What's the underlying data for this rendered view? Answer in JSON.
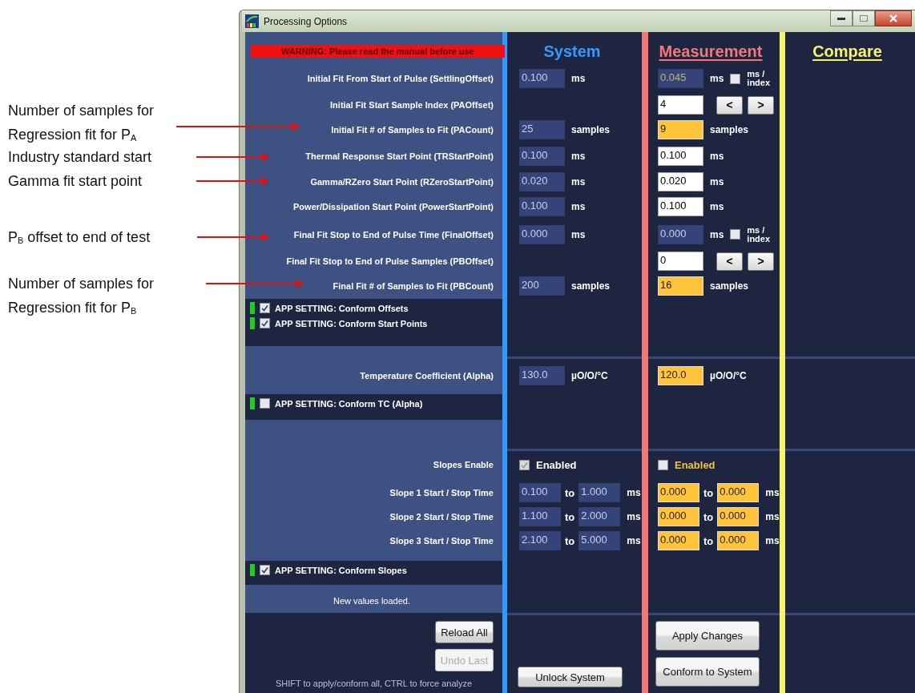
{
  "annotations": [
    {
      "text": "Number of samples for Regression fit for P$_{A}$"
    },
    {
      "text": "Industry standard start"
    },
    {
      "text": "Gamma fit start point"
    },
    {
      "text": "P$_{B}$ offset to end of test"
    },
    {
      "text": "Number of samples for Regression fit for P$_{B}$"
    }
  ],
  "window": {
    "title": "Processing Options"
  },
  "warning": "WARNING: Please read the manual before use",
  "columns": [
    {
      "title": "System",
      "color": "#3399ff",
      "underlined": false
    },
    {
      "title": "Measurement",
      "color": "#f27878",
      "underlined": true
    },
    {
      "title": "Compare",
      "color": "#f8f46a",
      "underlined": true
    }
  ],
  "params": [
    {
      "label": "Initial Fit From Start of Pulse (SettlingOffset)",
      "system": {
        "value": "0.100",
        "unit": "ms"
      },
      "measurement": {
        "value": "0.045",
        "kind": "locked-changed",
        "unit": "ms",
        "toggle": {
          "label": "ms / index",
          "checked": false
        }
      }
    },
    {
      "label": "Initial Fit Start Sample Index (PAOffset)",
      "measurement": {
        "value": "4",
        "kind": "edit",
        "steppers": [
          "<",
          ">"
        ]
      }
    },
    {
      "label": "Initial Fit # of Samples to Fit (PACount)",
      "system": {
        "value": "25",
        "unit": "samples"
      },
      "measurement": {
        "value": "9",
        "kind": "changed",
        "unit": "samples"
      }
    },
    {
      "label": "Thermal Response Start Point (TRStartPoint)",
      "system": {
        "value": "0.100",
        "unit": "ms"
      },
      "measurement": {
        "value": "0.100",
        "kind": "edit",
        "unit": "ms"
      }
    },
    {
      "label": "Gamma/RZero Start Point (RZeroStartPoint)",
      "system": {
        "value": "0.020",
        "unit": "ms"
      },
      "measurement": {
        "value": "0.020",
        "kind": "edit",
        "unit": "ms"
      }
    },
    {
      "label": "Power/Dissipation Start Point (PowerStartPoint)",
      "system": {
        "value": "0.100",
        "unit": "ms"
      },
      "measurement": {
        "value": "0.100",
        "kind": "edit",
        "unit": "ms"
      }
    },
    {
      "label": "Final Fit Stop to End of Pulse Time (FinalOffset)",
      "system": {
        "value": "0.000",
        "unit": "ms"
      },
      "measurement": {
        "value": "0.000",
        "kind": "locked",
        "unit": "ms",
        "toggle": {
          "label": "ms / index",
          "checked": false
        }
      }
    },
    {
      "label": "Final Fit Stop to End of Pulse Samples (PBOffset)",
      "measurement": {
        "value": "0",
        "kind": "edit",
        "steppers": [
          "<",
          ">"
        ]
      }
    },
    {
      "label": "Final Fit # of Samples to Fit (PBCount)",
      "system": {
        "value": "200",
        "unit": "samples"
      },
      "measurement": {
        "value": "16",
        "kind": "changed",
        "unit": "samples"
      }
    }
  ],
  "offset_settings": [
    {
      "label": "APP SETTING: Conform Offsets",
      "checked": true
    },
    {
      "label": "APP SETTING: Conform Start Points",
      "checked": true
    }
  ],
  "temperature": {
    "label": "Temperature Coefficient (Alpha)",
    "system": {
      "value": "130.0",
      "unit": "µO/O/°C"
    },
    "measurement": {
      "value": "120.0",
      "kind": "changed",
      "unit": "µO/O/°C"
    }
  },
  "tc_setting": {
    "label": "APP SETTING: Conform TC (Alpha)",
    "checked": false
  },
  "slopes": {
    "enable_label": "Slopes Enable",
    "system_enable": {
      "label": "Enabled",
      "checked": true,
      "disabled": true,
      "changed": false
    },
    "measurement_enable": {
      "label": "Enabled",
      "checked": false,
      "disabled": false,
      "changed": true
    },
    "rows": [
      {
        "label": "Slope 1 Start / Stop Time",
        "system": {
          "start": "0.100",
          "to": "to",
          "stop": "1.000",
          "unit": "ms"
        },
        "measurement": {
          "start": "0.000",
          "to": "to",
          "stop": "0.000",
          "unit": "ms"
        }
      },
      {
        "label": "Slope 2 Start / Stop Time",
        "system": {
          "start": "1.100",
          "to": "to",
          "stop": "2.000",
          "unit": "ms"
        },
        "measurement": {
          "start": "0.000",
          "to": "to",
          "stop": "0.000",
          "unit": "ms"
        }
      },
      {
        "label": "Slope 3 Start / Stop Time",
        "system": {
          "start": "2.100",
          "to": "to",
          "stop": "5.000",
          "unit": "ms"
        },
        "measurement": {
          "start": "0.000",
          "to": "to",
          "stop": "0.000",
          "unit": "ms"
        }
      }
    ]
  },
  "slope_setting": {
    "label": "APP SETTING: Conform Slopes",
    "checked": true
  },
  "status": "New values loaded.",
  "left_buttons": [
    {
      "label": "Reload All",
      "disabled": false
    },
    {
      "label": "Undo Last",
      "disabled": true
    }
  ],
  "hint": "SHIFT to apply/conform all, CTRL to force analyze",
  "system_buttons": [
    {
      "label": "Unlock System",
      "disabled": false
    }
  ],
  "measurement_buttons": [
    {
      "label": "Apply Changes",
      "disabled": false
    },
    {
      "label": "Conform to System",
      "disabled": false
    }
  ]
}
